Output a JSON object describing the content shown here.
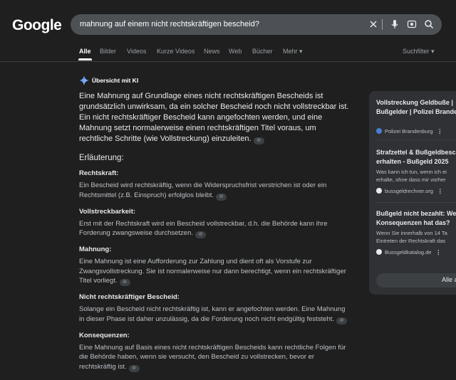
{
  "header": {
    "logo": "Google",
    "query": "mahnung auf einem nicht rechtskräftigen bescheid?",
    "icons": [
      "close-icon",
      "microphone-icon",
      "lens-icon",
      "search-icon"
    ]
  },
  "tabs": [
    {
      "label": "Alle",
      "active": true
    },
    {
      "label": "Bilder"
    },
    {
      "label": "Videos"
    },
    {
      "label": "Kurze Videos"
    },
    {
      "label": "News"
    },
    {
      "label": "Web"
    },
    {
      "label": "Bücher"
    },
    {
      "label": "Mehr"
    }
  ],
  "search_filter": "Suchfilter",
  "ai_overview": {
    "heading": "Übersicht mit KI",
    "intro": "Eine Mahnung auf Grundlage eines nicht rechtskräftigen Bescheids ist grundsätzlich unwirksam, da ein solcher Bescheid noch nicht vollstreckbar ist. Ein nicht rechtskräftiger Bescheid kann angefochten werden, und eine Mahnung setzt normalerweise einen rechtskräftigen Titel voraus, um rechtliche Schritte (wie Vollstreckung) einzuleiten.",
    "explain_heading": "Erläuterung:",
    "sections": [
      {
        "title": "Rechtskraft:",
        "text": "Ein Bescheid wird rechtskräftig, wenn die Widerspruchsfrist verstrichen ist oder ein Rechtsmittel (z.B. Einspruch) erfolglos bleibt."
      },
      {
        "title": "Vollstreckbarkeit:",
        "text": "Erst mit der Rechtskraft wird ein Bescheid vollstreckbar, d.h. die Behörde kann ihre Forderung zwangsweise durchsetzen."
      },
      {
        "title": "Mahnung:",
        "text": "Eine Mahnung ist eine Aufforderung zur Zahlung und dient oft als Vorstufe zur Zwangsvollstreckung. Sie ist normalerweise nur dann berechtigt, wenn ein rechtskräftiger Titel vorliegt."
      },
      {
        "title": "Nicht rechtskräftiger Bescheid:",
        "text": "Solange ein Bescheid nicht rechtskräftig ist, kann er angefochten werden. Eine Mahnung in dieser Phase ist daher unzulässig, da die Forderung noch nicht endgültig feststeht."
      },
      {
        "title": "Konsequenzen:",
        "text": "Eine Mahnung auf Basis eines nicht rechtskräftigen Bescheids kann rechtliche Folgen für die Behörde haben, wenn sie versucht, den Bescheid zu vollstrecken, bevor er rechtskräftig ist."
      }
    ]
  },
  "sources": {
    "cards": [
      {
        "title1": "Vollstreckung Geldbuße |",
        "title2": "Bußgelder | Polizei Brande",
        "desc1": "",
        "desc2": "",
        "source": "Polizei Brandenburg",
        "color": "#4a7fd4"
      },
      {
        "title1": "Strafzettel & Bußgeldbesc",
        "title2": "erhalten - Bußgeld 2025",
        "desc1": "Was kann ich tun, wenn ich ei",
        "desc2": "erhalte, ohne dass mir vorher",
        "source": "bussgeldrechner.org",
        "color": "#e8eaed"
      },
      {
        "title1": "Bußgeld nicht bezahlt: We",
        "title2": "Konsequenzen hat das?",
        "desc1": "Wenn Sie innerhalb von 14 Ta",
        "desc2": "Eintreten der Rechtskraft das",
        "source": "Bussgeldkatalog.de",
        "color": "#e8eaed"
      }
    ],
    "more_icon": "more-vert-icon",
    "all_button": "Alle a"
  }
}
